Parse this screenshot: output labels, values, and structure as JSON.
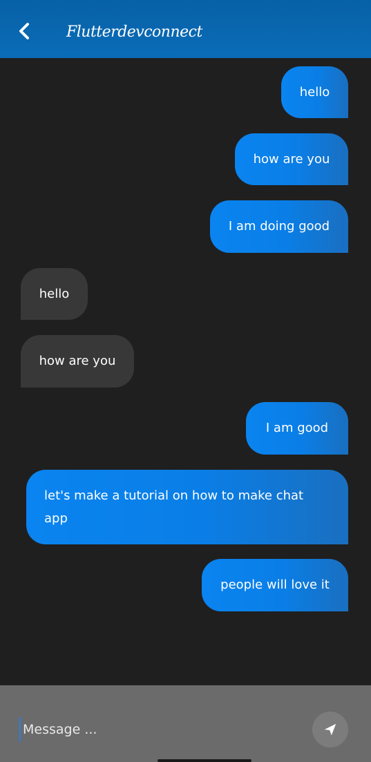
{
  "appbar": {
    "title": "Flutterdevconnect",
    "back_icon": "chevron-left-icon",
    "color": "#0a66b0"
  },
  "messages": [
    {
      "text": "hello",
      "sender": "me"
    },
    {
      "text": "how are you",
      "sender": "me"
    },
    {
      "text": "I am doing good",
      "sender": "me"
    },
    {
      "text": "hello",
      "sender": "other"
    },
    {
      "text": "how are you",
      "sender": "other"
    },
    {
      "text": "I am good",
      "sender": "me"
    },
    {
      "text": "let's make a tutorial on how to make chat app",
      "sender": "me"
    },
    {
      "text": "people will love it",
      "sender": "me"
    }
  ],
  "composer": {
    "placeholder": "Message ...",
    "value": "",
    "send_icon": "send-icon"
  },
  "colors": {
    "background": "#1f1f1f",
    "sent_bubble": "#0a84f0",
    "received_bubble": "#383838",
    "composer": "#6b6b6b"
  }
}
